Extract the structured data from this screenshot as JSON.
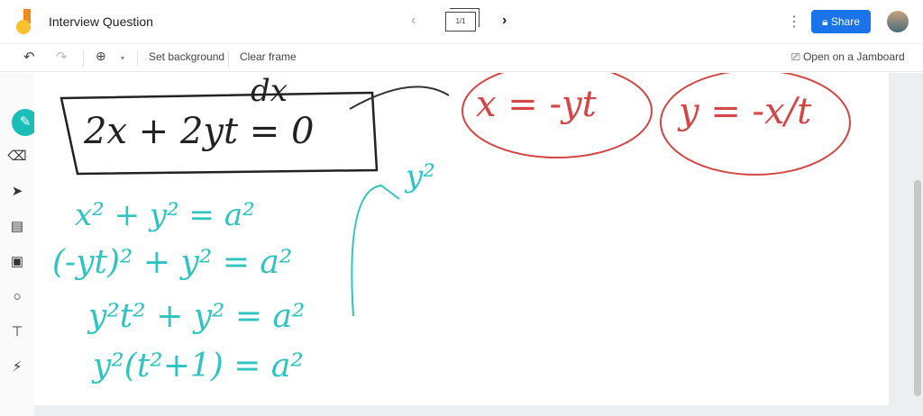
{
  "header": {
    "title": "Interview Question",
    "frame_indicator": "1/1",
    "share_label": "Share",
    "prev": "‹",
    "next": "›",
    "more": "⋮"
  },
  "toolbar": {
    "set_background": "Set background",
    "clear_frame": "Clear frame",
    "open_jamboard": "Open on a Jamboard",
    "zoom_caret": "▾"
  },
  "tools": [
    "pen",
    "eraser",
    "select",
    "sticky-note",
    "image",
    "circle",
    "text-box",
    "laser"
  ],
  "board": {
    "black": [
      "dx",
      "2x + 2yt = 0"
    ],
    "red": [
      "x = -yt",
      "y = -x/t"
    ],
    "teal": [
      "x² + y² = a²",
      "(-yt)² + y² = a²",
      "y²t² + y² = a²",
      "y²(t²+1) = a²",
      "y²"
    ]
  },
  "colors": {
    "accent": "#1a73e8",
    "teal_ink": "#2ec4c0",
    "red_ink": "#d64545",
    "pen_active": "#19bfb7"
  }
}
